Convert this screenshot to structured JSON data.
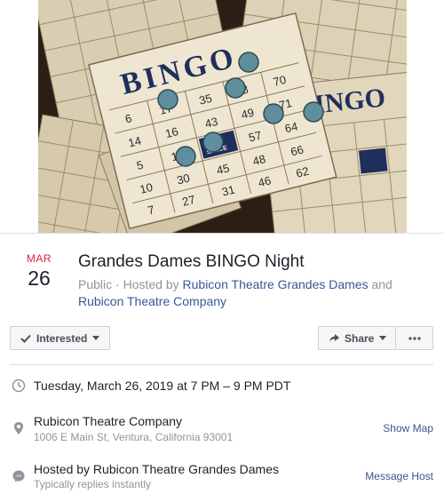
{
  "event": {
    "month": "MAR",
    "day": "26",
    "title": "Grandes Dames BINGO Night",
    "visibility": "Public",
    "hosted_by_prefix": "· Hosted by",
    "host_one": "Rubicon Theatre Grandes Dames",
    "and_word": "and",
    "host_two": "Rubicon Theatre Company"
  },
  "actions": {
    "interested_label": "Interested",
    "share_label": "Share"
  },
  "details": {
    "datetime": "Tuesday, March 26, 2019 at 7 PM – 9 PM PDT",
    "venue_name": "Rubicon Theatre Company",
    "venue_address": "1006 E Main St, Ventura, California 93001",
    "show_map_label": "Show Map",
    "hosted_line": "Hosted by Rubicon Theatre Grandes Dames",
    "reply_note": "Typically replies instantly",
    "message_host_label": "Message Host"
  },
  "card_text": {
    "bingo": "BINGO",
    "free_space": "FREE SPACE"
  },
  "colors": {
    "accent_red": "#e41e3f",
    "link_blue": "#365899",
    "card_paper": "#efe6d2",
    "card_ink": "#1f2f5c",
    "chip_blue": "#5f8e9c"
  },
  "icons": {
    "interested": "checkmark-icon",
    "share": "share-arrow-icon",
    "more": "ellipsis-icon",
    "time": "clock-icon",
    "location": "map-pin-icon",
    "host": "messenger-icon"
  }
}
